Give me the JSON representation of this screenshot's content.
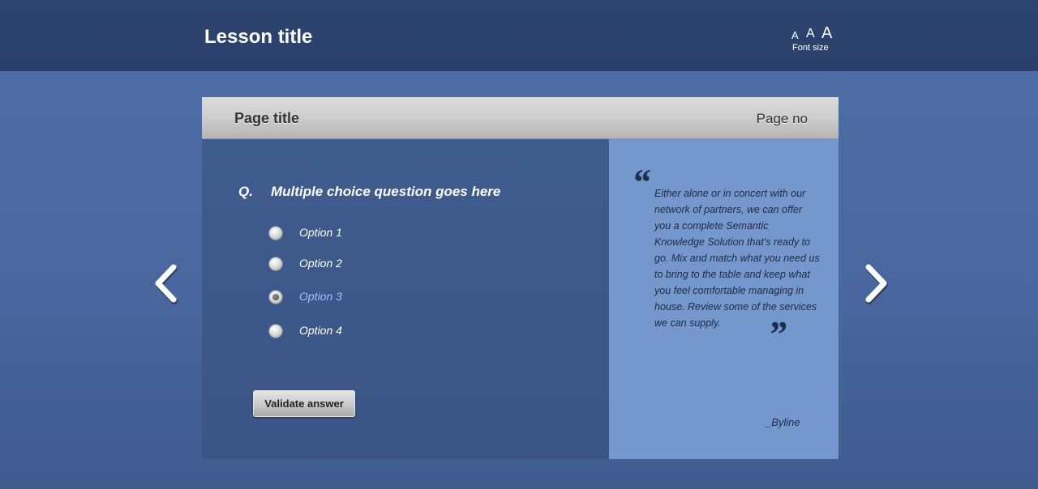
{
  "header": {
    "lesson_title": "Lesson title",
    "font_size": {
      "small": "A",
      "medium": "A",
      "large": "A",
      "label": "Font size"
    }
  },
  "panel": {
    "page_title": "Page title",
    "page_no": "Page no"
  },
  "question": {
    "label": "Q.",
    "text": "Multiple choice question goes here",
    "options": [
      {
        "label": "Option 1",
        "selected": false
      },
      {
        "label": "Option 2",
        "selected": false
      },
      {
        "label": "Option 3",
        "selected": true
      },
      {
        "label": "Option 4",
        "selected": false
      }
    ],
    "validate_label": "Validate answer"
  },
  "quote": {
    "open_mark": "“",
    "close_mark": "”",
    "text": "Either alone or in concert with our network of partners, we can offer you a complete Semantic Knowledge Solution that's ready to go. Mix and match what you need us to bring to the table and keep what you feel comfortable managing in house. Review some of the services we can supply.",
    "byline": "_Byline"
  },
  "navigation": {
    "prev_icon": "chevron-left-icon",
    "next_icon": "chevron-right-icon"
  },
  "colors": {
    "background": "#4a68a0",
    "topbar": "#2d436f",
    "question_panel": "#3d5a8b",
    "quote_panel": "#7497cd",
    "selected_option": "#9fc0ff"
  }
}
